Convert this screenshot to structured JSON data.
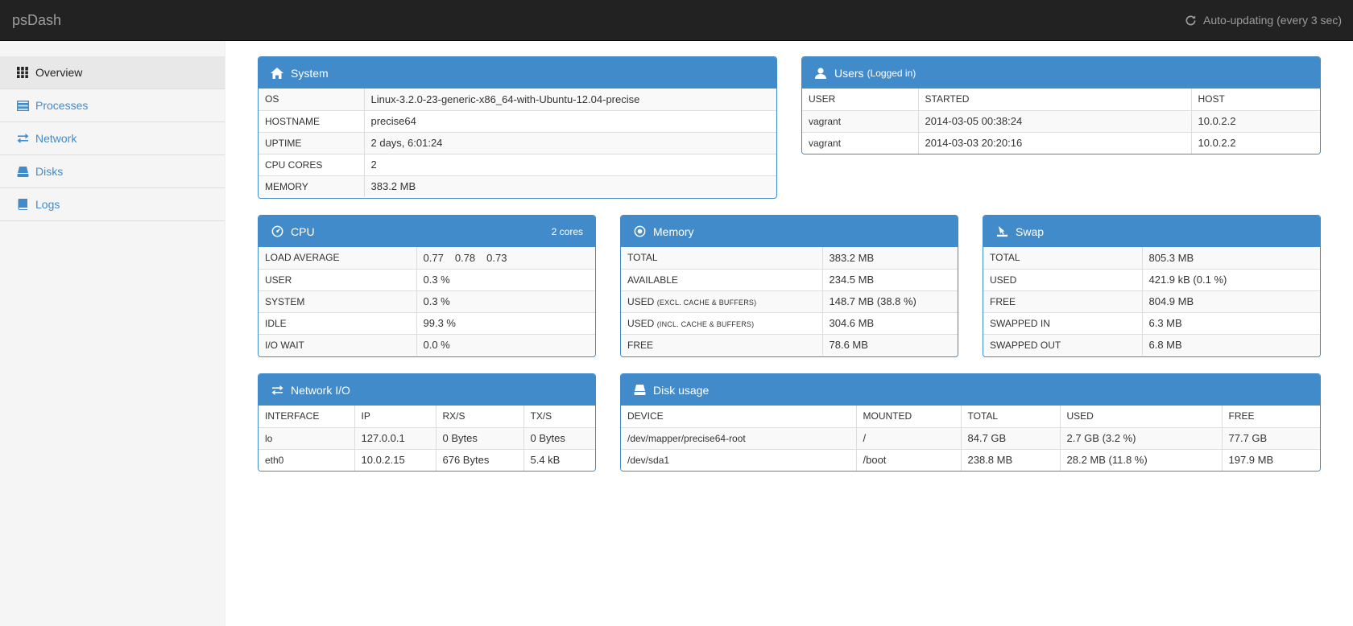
{
  "app": {
    "brand": "psDash",
    "auto_update": "Auto-updating (every 3 sec)"
  },
  "sidebar": {
    "items": [
      {
        "label": "Overview",
        "icon": "th-icon",
        "active": true
      },
      {
        "label": "Processes",
        "icon": "tasks-icon",
        "active": false
      },
      {
        "label": "Network",
        "icon": "transfer-icon",
        "active": false
      },
      {
        "label": "Disks",
        "icon": "hdd-icon",
        "active": false
      },
      {
        "label": "Logs",
        "icon": "book-icon",
        "active": false
      }
    ]
  },
  "system": {
    "title": "System",
    "rows": [
      {
        "k": "OS",
        "v": "Linux-3.2.0-23-generic-x86_64-with-Ubuntu-12.04-precise"
      },
      {
        "k": "HOSTNAME",
        "v": "precise64"
      },
      {
        "k": "UPTIME",
        "v": "2 days, 6:01:24"
      },
      {
        "k": "CPU CORES",
        "v": "2"
      },
      {
        "k": "MEMORY",
        "v": "383.2 MB"
      }
    ]
  },
  "users": {
    "title": "Users",
    "subtitle": "(Logged in)",
    "headers": [
      "USER",
      "STARTED",
      "HOST"
    ],
    "rows": [
      [
        "vagrant",
        "2014-03-05 00:38:24",
        "10.0.2.2"
      ],
      [
        "vagrant",
        "2014-03-03 20:20:16",
        "10.0.2.2"
      ]
    ]
  },
  "cpu": {
    "title": "CPU",
    "cores_badge": "2 cores",
    "load_label": "LOAD AVERAGE",
    "load": [
      "0.77",
      "0.78",
      "0.73"
    ],
    "rows": [
      {
        "k": "USER",
        "v": "0.3 %"
      },
      {
        "k": "SYSTEM",
        "v": "0.3 %"
      },
      {
        "k": "IDLE",
        "v": "99.3 %"
      },
      {
        "k": "I/O WAIT",
        "v": "0.0 %"
      }
    ]
  },
  "memory": {
    "title": "Memory",
    "rows": [
      {
        "k": "TOTAL",
        "note": "",
        "v": "383.2 MB"
      },
      {
        "k": "AVAILABLE",
        "note": "",
        "v": "234.5 MB"
      },
      {
        "k": "USED",
        "note": "(EXCL. CACHE & BUFFERS)",
        "v": "148.7 MB (38.8 %)"
      },
      {
        "k": "USED",
        "note": "(INCL. CACHE & BUFFERS)",
        "v": "304.6 MB"
      },
      {
        "k": "FREE",
        "note": "",
        "v": "78.6 MB"
      }
    ]
  },
  "swap": {
    "title": "Swap",
    "rows": [
      {
        "k": "TOTAL",
        "v": "805.3 MB"
      },
      {
        "k": "USED",
        "v": "421.9 kB (0.1 %)"
      },
      {
        "k": "FREE",
        "v": "804.9 MB"
      },
      {
        "k": "SWAPPED IN",
        "v": "6.3 MB"
      },
      {
        "k": "SWAPPED OUT",
        "v": "6.8 MB"
      }
    ]
  },
  "network": {
    "title": "Network I/O",
    "headers": [
      "INTERFACE",
      "IP",
      "RX/S",
      "TX/S"
    ],
    "rows": [
      [
        "lo",
        "127.0.0.1",
        "0 Bytes",
        "0 Bytes"
      ],
      [
        "eth0",
        "10.0.2.15",
        "676 Bytes",
        "5.4 kB"
      ]
    ]
  },
  "disks": {
    "title": "Disk usage",
    "headers": [
      "DEVICE",
      "MOUNTED",
      "TOTAL",
      "USED",
      "FREE"
    ],
    "rows": [
      [
        "/dev/mapper/precise64-root",
        "/",
        "84.7 GB",
        "2.7 GB (3.2 %)",
        "77.7 GB"
      ],
      [
        "/dev/sda1",
        "/boot",
        "238.8 MB",
        "28.2 MB (11.8 %)",
        "197.9 MB"
      ]
    ]
  },
  "colors": {
    "primary": "#428bca",
    "navbar": "#222222",
    "sidebar": "#f5f5f5"
  }
}
